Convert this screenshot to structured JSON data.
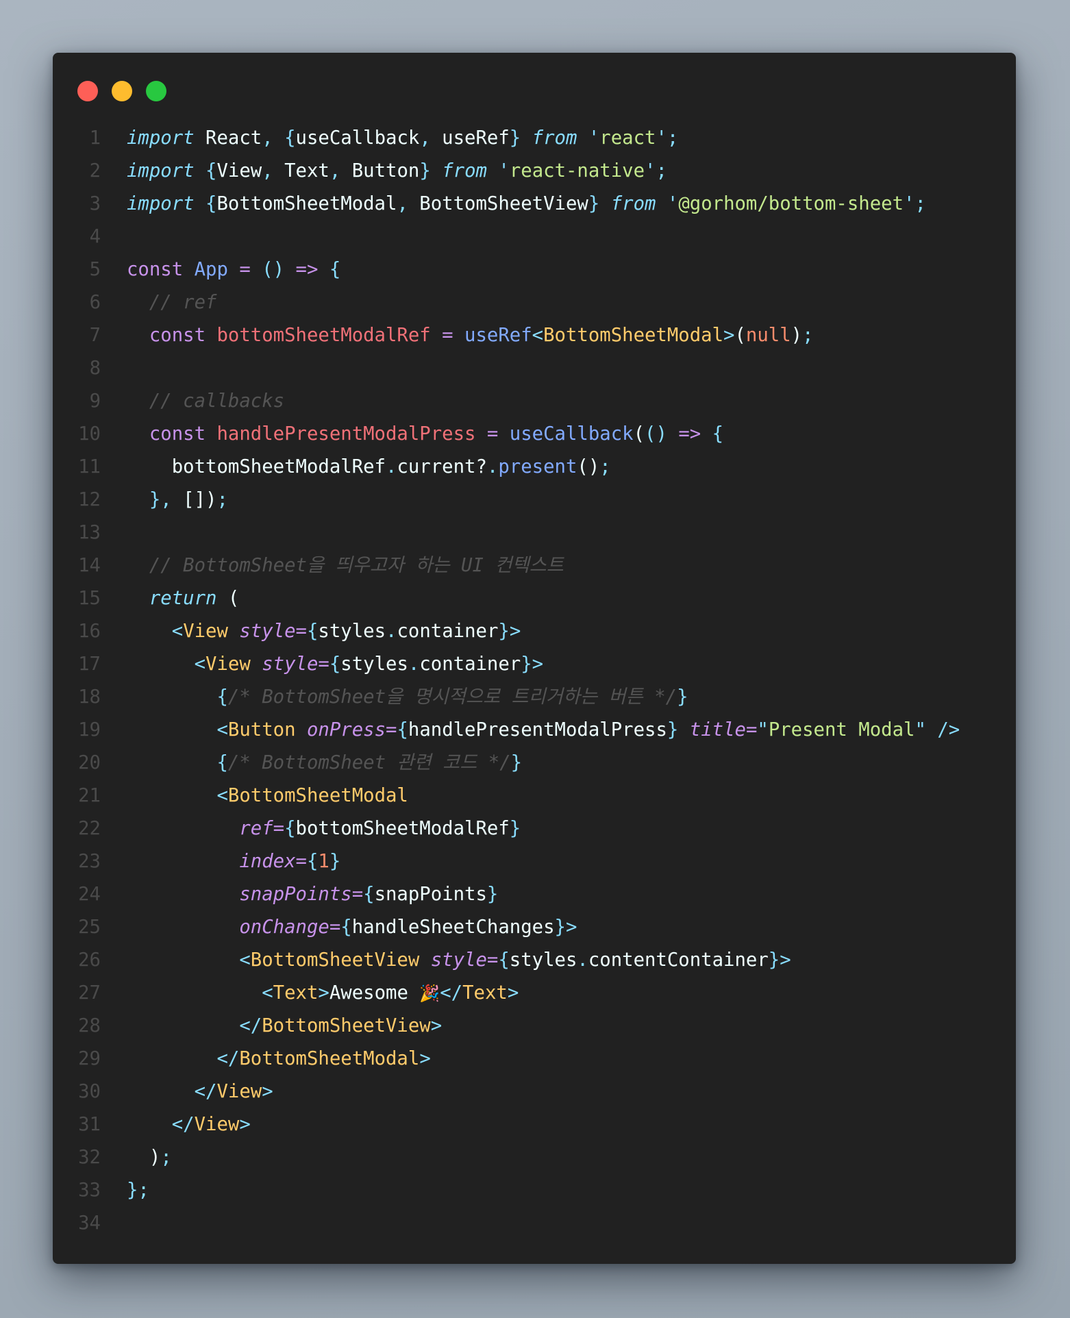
{
  "window": {
    "traffic_lights": [
      {
        "name": "close",
        "color": "#fe5f57"
      },
      {
        "name": "minimize",
        "color": "#febc2e"
      },
      {
        "name": "maximize",
        "color": "#28c840"
      }
    ]
  },
  "theme": {
    "background": "#212121",
    "colors": {
      "keyword": "#c792ea",
      "control": "#89ddff",
      "function": "#82aaff",
      "variable": "#f07178",
      "tag": "#ffcb6b",
      "string": "#c3e88d",
      "number": "#f78c6c",
      "comment": "#545454",
      "line_number": "#4a4a4a",
      "text": "#eeffff"
    }
  },
  "code": {
    "lines": [
      {
        "n": "1",
        "tokens": [
          [
            "kwi",
            "import"
          ],
          [
            "plain",
            " React"
          ],
          [
            "punc",
            ","
          ],
          [
            "plain",
            " "
          ],
          [
            "punc",
            "{"
          ],
          [
            "plain",
            "useCallback"
          ],
          [
            "punc",
            ","
          ],
          [
            "plain",
            " useRef"
          ],
          [
            "punc",
            "}"
          ],
          [
            "plain",
            " "
          ],
          [
            "kwi",
            "from"
          ],
          [
            "plain",
            " "
          ],
          [
            "punc",
            "'"
          ],
          [
            "str",
            "react"
          ],
          [
            "punc",
            "'"
          ],
          [
            "punc",
            ";"
          ]
        ]
      },
      {
        "n": "2",
        "tokens": [
          [
            "kwi",
            "import"
          ],
          [
            "plain",
            " "
          ],
          [
            "punc",
            "{"
          ],
          [
            "plain",
            "View"
          ],
          [
            "punc",
            ","
          ],
          [
            "plain",
            " Text"
          ],
          [
            "punc",
            ","
          ],
          [
            "plain",
            " Button"
          ],
          [
            "punc",
            "}"
          ],
          [
            "plain",
            " "
          ],
          [
            "kwi",
            "from"
          ],
          [
            "plain",
            " "
          ],
          [
            "punc",
            "'"
          ],
          [
            "str",
            "react-native"
          ],
          [
            "punc",
            "'"
          ],
          [
            "punc",
            ";"
          ]
        ]
      },
      {
        "n": "3",
        "tokens": [
          [
            "kwi",
            "import"
          ],
          [
            "plain",
            " "
          ],
          [
            "punc",
            "{"
          ],
          [
            "plain",
            "BottomSheetModal"
          ],
          [
            "punc",
            ","
          ],
          [
            "plain",
            " BottomSheetView"
          ],
          [
            "punc",
            "}"
          ],
          [
            "plain",
            " "
          ],
          [
            "kwi",
            "from"
          ],
          [
            "plain",
            " "
          ],
          [
            "punc",
            "'"
          ],
          [
            "str",
            "@gorhom/bottom-sheet"
          ],
          [
            "punc",
            "'"
          ],
          [
            "punc",
            ";"
          ]
        ]
      },
      {
        "n": "4",
        "tokens": []
      },
      {
        "n": "5",
        "tokens": [
          [
            "kw",
            "const"
          ],
          [
            "plain",
            " "
          ],
          [
            "fn",
            "App"
          ],
          [
            "plain",
            " "
          ],
          [
            "kw",
            "="
          ],
          [
            "plain",
            " "
          ],
          [
            "punc",
            "()"
          ],
          [
            "plain",
            " "
          ],
          [
            "kw",
            "=>"
          ],
          [
            "plain",
            " "
          ],
          [
            "punc",
            "{"
          ]
        ]
      },
      {
        "n": "6",
        "tokens": [
          [
            "plain",
            "  "
          ],
          [
            "cmt",
            "// ref"
          ]
        ]
      },
      {
        "n": "7",
        "tokens": [
          [
            "plain",
            "  "
          ],
          [
            "kw",
            "const"
          ],
          [
            "plain",
            " "
          ],
          [
            "var",
            "bottomSheetModalRef"
          ],
          [
            "plain",
            " "
          ],
          [
            "kw",
            "="
          ],
          [
            "plain",
            " "
          ],
          [
            "fn",
            "useRef"
          ],
          [
            "punc",
            "<"
          ],
          [
            "tag",
            "BottomSheetModal"
          ],
          [
            "punc",
            ">"
          ],
          [
            "plain",
            "("
          ],
          [
            "num",
            "null"
          ],
          [
            "plain",
            ")"
          ],
          [
            "punc",
            ";"
          ]
        ]
      },
      {
        "n": "8",
        "tokens": []
      },
      {
        "n": "9",
        "tokens": [
          [
            "plain",
            "  "
          ],
          [
            "cmt",
            "// callbacks"
          ]
        ]
      },
      {
        "n": "10",
        "tokens": [
          [
            "plain",
            "  "
          ],
          [
            "kw",
            "const"
          ],
          [
            "plain",
            " "
          ],
          [
            "var",
            "handlePresentModalPress"
          ],
          [
            "plain",
            " "
          ],
          [
            "kw",
            "="
          ],
          [
            "plain",
            " "
          ],
          [
            "fn",
            "useCallback"
          ],
          [
            "plain",
            "("
          ],
          [
            "punc",
            "()"
          ],
          [
            "plain",
            " "
          ],
          [
            "kw",
            "=>"
          ],
          [
            "plain",
            " "
          ],
          [
            "punc",
            "{"
          ]
        ]
      },
      {
        "n": "11",
        "tokens": [
          [
            "plain",
            "    bottomSheetModalRef"
          ],
          [
            "punc",
            "."
          ],
          [
            "plain",
            "current?"
          ],
          [
            "punc",
            "."
          ],
          [
            "fn",
            "present"
          ],
          [
            "plain",
            "()"
          ],
          [
            "punc",
            ";"
          ]
        ]
      },
      {
        "n": "12",
        "tokens": [
          [
            "plain",
            "  "
          ],
          [
            "punc",
            "},"
          ],
          [
            "plain",
            " [])"
          ],
          [
            "punc",
            ";"
          ]
        ]
      },
      {
        "n": "13",
        "tokens": []
      },
      {
        "n": "14",
        "tokens": [
          [
            "plain",
            "  "
          ],
          [
            "cmt",
            "// BottomSheet을 띄우고자 하는 UI 컨텍스트"
          ]
        ]
      },
      {
        "n": "15",
        "tokens": [
          [
            "plain",
            "  "
          ],
          [
            "kwi",
            "return"
          ],
          [
            "plain",
            " ("
          ]
        ]
      },
      {
        "n": "16",
        "tokens": [
          [
            "plain",
            "    "
          ],
          [
            "punc",
            "<"
          ],
          [
            "tag",
            "View"
          ],
          [
            "plain",
            " "
          ],
          [
            "attr",
            "style"
          ],
          [
            "kw",
            "="
          ],
          [
            "punc",
            "{"
          ],
          [
            "plain",
            "styles"
          ],
          [
            "punc",
            "."
          ],
          [
            "plain",
            "container"
          ],
          [
            "punc",
            "}>"
          ]
        ]
      },
      {
        "n": "17",
        "tokens": [
          [
            "plain",
            "      "
          ],
          [
            "punc",
            "<"
          ],
          [
            "tag",
            "View"
          ],
          [
            "plain",
            " "
          ],
          [
            "attr",
            "style"
          ],
          [
            "kw",
            "="
          ],
          [
            "punc",
            "{"
          ],
          [
            "plain",
            "styles"
          ],
          [
            "punc",
            "."
          ],
          [
            "plain",
            "container"
          ],
          [
            "punc",
            "}>"
          ]
        ]
      },
      {
        "n": "18",
        "tokens": [
          [
            "plain",
            "        "
          ],
          [
            "punc",
            "{"
          ],
          [
            "cmt",
            "/* BottomSheet을 명시적으로 트리거하는 버튼 */"
          ],
          [
            "punc",
            "}"
          ]
        ]
      },
      {
        "n": "19",
        "tokens": [
          [
            "plain",
            "        "
          ],
          [
            "punc",
            "<"
          ],
          [
            "tag",
            "Button"
          ],
          [
            "plain",
            " "
          ],
          [
            "attr",
            "onPress"
          ],
          [
            "kw",
            "="
          ],
          [
            "punc",
            "{"
          ],
          [
            "plain",
            "handlePresentModalPress"
          ],
          [
            "punc",
            "}"
          ],
          [
            "plain",
            " "
          ],
          [
            "attr",
            "title"
          ],
          [
            "kw",
            "="
          ],
          [
            "punc",
            "\""
          ],
          [
            "str",
            "Present Modal"
          ],
          [
            "punc",
            "\""
          ],
          [
            "plain",
            " "
          ],
          [
            "punc",
            "/>"
          ]
        ]
      },
      {
        "n": "20",
        "tokens": [
          [
            "plain",
            "        "
          ],
          [
            "punc",
            "{"
          ],
          [
            "cmt",
            "/* BottomSheet 관련 코드 */"
          ],
          [
            "punc",
            "}"
          ]
        ]
      },
      {
        "n": "21",
        "tokens": [
          [
            "plain",
            "        "
          ],
          [
            "punc",
            "<"
          ],
          [
            "tag",
            "BottomSheetModal"
          ]
        ]
      },
      {
        "n": "22",
        "tokens": [
          [
            "plain",
            "          "
          ],
          [
            "attr",
            "ref"
          ],
          [
            "kw",
            "="
          ],
          [
            "punc",
            "{"
          ],
          [
            "plain",
            "bottomSheetModalRef"
          ],
          [
            "punc",
            "}"
          ]
        ]
      },
      {
        "n": "23",
        "tokens": [
          [
            "plain",
            "          "
          ],
          [
            "attr",
            "index"
          ],
          [
            "kw",
            "="
          ],
          [
            "punc",
            "{"
          ],
          [
            "num",
            "1"
          ],
          [
            "punc",
            "}"
          ]
        ]
      },
      {
        "n": "24",
        "tokens": [
          [
            "plain",
            "          "
          ],
          [
            "attr",
            "snapPoints"
          ],
          [
            "kw",
            "="
          ],
          [
            "punc",
            "{"
          ],
          [
            "plain",
            "snapPoints"
          ],
          [
            "punc",
            "}"
          ]
        ]
      },
      {
        "n": "25",
        "tokens": [
          [
            "plain",
            "          "
          ],
          [
            "attr",
            "onChange"
          ],
          [
            "kw",
            "="
          ],
          [
            "punc",
            "{"
          ],
          [
            "plain",
            "handleSheetChanges"
          ],
          [
            "punc",
            "}>"
          ]
        ]
      },
      {
        "n": "26",
        "tokens": [
          [
            "plain",
            "          "
          ],
          [
            "punc",
            "<"
          ],
          [
            "tag",
            "BottomSheetView"
          ],
          [
            "plain",
            " "
          ],
          [
            "attr",
            "style"
          ],
          [
            "kw",
            "="
          ],
          [
            "punc",
            "{"
          ],
          [
            "plain",
            "styles"
          ],
          [
            "punc",
            "."
          ],
          [
            "plain",
            "contentContainer"
          ],
          [
            "punc",
            "}>"
          ]
        ]
      },
      {
        "n": "27",
        "tokens": [
          [
            "plain",
            "            "
          ],
          [
            "punc",
            "<"
          ],
          [
            "tag",
            "Text"
          ],
          [
            "punc",
            ">"
          ],
          [
            "plain",
            "Awesome "
          ],
          [
            "emoji",
            "🎉"
          ],
          [
            "punc",
            "</"
          ],
          [
            "tag",
            "Text"
          ],
          [
            "punc",
            ">"
          ]
        ]
      },
      {
        "n": "28",
        "tokens": [
          [
            "plain",
            "          "
          ],
          [
            "punc",
            "</"
          ],
          [
            "tag",
            "BottomSheetView"
          ],
          [
            "punc",
            ">"
          ]
        ]
      },
      {
        "n": "29",
        "tokens": [
          [
            "plain",
            "        "
          ],
          [
            "punc",
            "</"
          ],
          [
            "tag",
            "BottomSheetModal"
          ],
          [
            "punc",
            ">"
          ]
        ]
      },
      {
        "n": "30",
        "tokens": [
          [
            "plain",
            "      "
          ],
          [
            "punc",
            "</"
          ],
          [
            "tag",
            "View"
          ],
          [
            "punc",
            ">"
          ]
        ]
      },
      {
        "n": "31",
        "tokens": [
          [
            "plain",
            "    "
          ],
          [
            "punc",
            "</"
          ],
          [
            "tag",
            "View"
          ],
          [
            "punc",
            ">"
          ]
        ]
      },
      {
        "n": "32",
        "tokens": [
          [
            "plain",
            "  )"
          ],
          [
            "punc",
            ";"
          ]
        ]
      },
      {
        "n": "33",
        "tokens": [
          [
            "punc",
            "};"
          ]
        ]
      },
      {
        "n": "34",
        "tokens": []
      }
    ]
  }
}
